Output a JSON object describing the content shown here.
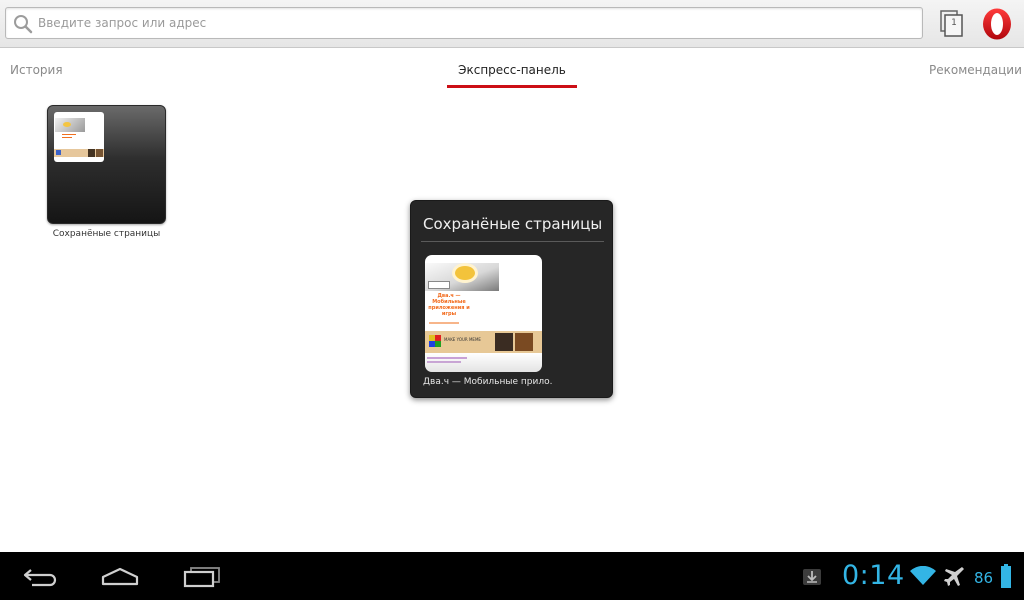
{
  "address_bar": {
    "placeholder": "Введите запрос или адрес",
    "value": ""
  },
  "toolbar": {
    "tab_count": "1"
  },
  "nav": {
    "history": "История",
    "speed_dial": "Экспресс-панель",
    "recommendations": "Рекомендации"
  },
  "speed_dial": {
    "folder_label": "Сохранёные страницы"
  },
  "popup": {
    "title": "Сохранёные страницы",
    "items": [
      {
        "label": "Два.ч — Мобильные прило..."
      }
    ]
  },
  "thumbnail_page": {
    "heading": "Два.ч — Мобильные приложения и игры",
    "banner": "MAKE YOUR MEME"
  },
  "status_bar": {
    "time": "0:14",
    "battery": "86"
  },
  "colors": {
    "accent_red": "#cc0f16",
    "status_blue": "#33b5e5"
  },
  "icons": [
    "search-icon",
    "tabs-icon",
    "opera-logo-icon",
    "back-icon",
    "home-icon",
    "recent-apps-icon",
    "download-icon",
    "wifi-icon",
    "airplane-icon",
    "battery-icon"
  ]
}
